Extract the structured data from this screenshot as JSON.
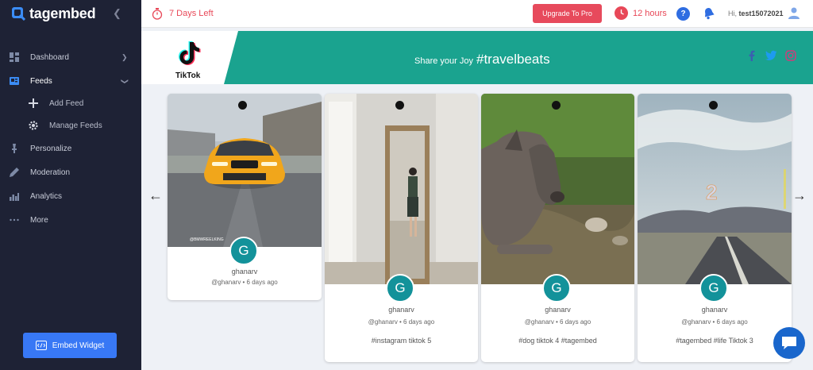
{
  "sidebar": {
    "brand": "tagembed",
    "items": [
      {
        "label": "Dashboard",
        "icon": "dashboard-icon"
      },
      {
        "label": "Feeds",
        "icon": "feeds-icon"
      },
      {
        "label": "Personalize",
        "icon": "personalize-icon"
      },
      {
        "label": "Moderation",
        "icon": "moderation-icon"
      },
      {
        "label": "Analytics",
        "icon": "analytics-icon"
      },
      {
        "label": "More",
        "icon": "more-icon"
      }
    ],
    "sub_items": [
      {
        "label": "Add Feed",
        "icon": "plus-icon"
      },
      {
        "label": "Manage Feeds",
        "icon": "gear-icon"
      }
    ],
    "embed_label": "Embed Widget"
  },
  "topbar": {
    "trial": "7 Days Left",
    "upgrade": "Upgrade To Pro",
    "hours": "12 hours",
    "help": "?",
    "greeting_prefix": "Hi,",
    "username": "test15072021"
  },
  "banner": {
    "logo_text": "TikTok",
    "tagline": "Share your Joy",
    "hashtag": "#travelbeats"
  },
  "cards": [
    {
      "avatar": "G",
      "name": "ghanarv",
      "meta": "@ghanarv • 6 days ago",
      "caption": ""
    },
    {
      "avatar": "G",
      "name": "ghanarv",
      "meta": "@ghanarv • 6 days ago",
      "caption": "#instagram tiktok 5"
    },
    {
      "avatar": "G",
      "name": "ghanarv",
      "meta": "@ghanarv • 6 days ago",
      "caption": "#dog tiktok 4 #tagembed"
    },
    {
      "avatar": "G",
      "name": "ghanarv",
      "meta": "@ghanarv • 6 days ago",
      "caption": "#tagembed #life Tiktok 3"
    }
  ],
  "nav": {
    "prev": "←",
    "next": "→"
  },
  "colors": {
    "sidebar_bg": "#1e2235",
    "accent_blue": "#3878f5",
    "alert_red": "#e74a5c",
    "banner_teal": "#1aa38f",
    "avatar_teal": "#13929a"
  }
}
